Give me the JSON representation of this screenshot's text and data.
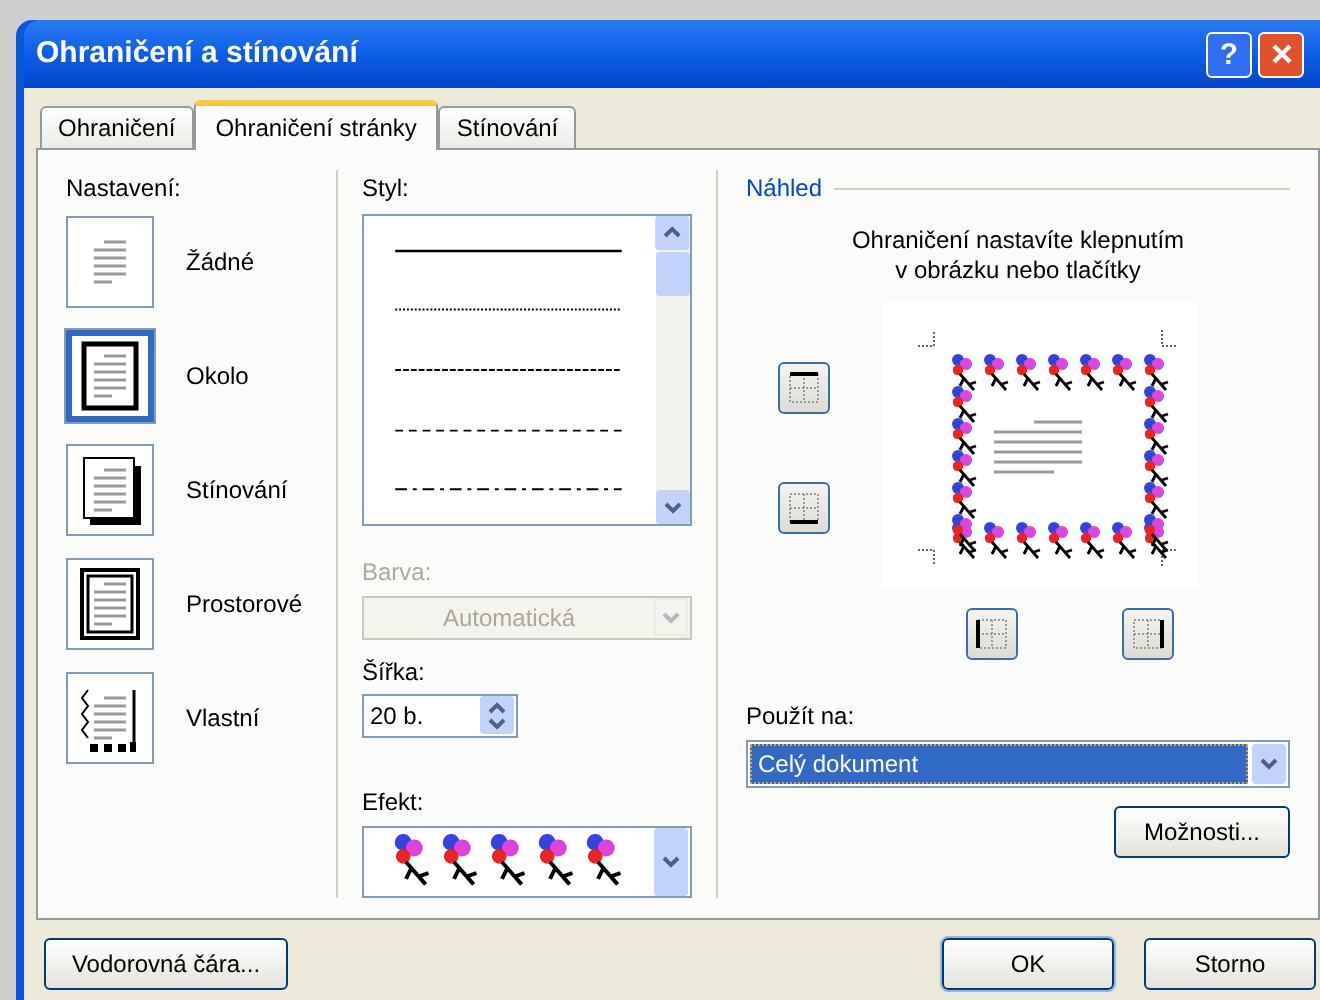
{
  "window": {
    "title": "Ohraničení a stínování",
    "help": "?"
  },
  "tabs": [
    {
      "label": "Ohraničení",
      "selected": false
    },
    {
      "label": "Ohraničení stránky",
      "selected": true
    },
    {
      "label": "Stínování",
      "selected": false
    }
  ],
  "settings": {
    "label": "Nastavení:",
    "items": [
      {
        "label": "Žádné",
        "kind": "none",
        "selected": false
      },
      {
        "label": "Okolo",
        "kind": "box",
        "selected": true
      },
      {
        "label": "Stínování",
        "kind": "shadow",
        "selected": false
      },
      {
        "label": "Prostorové",
        "kind": "threedee",
        "selected": false
      },
      {
        "label": "Vlastní",
        "kind": "custom",
        "selected": false
      }
    ]
  },
  "style": {
    "label": "Styl:"
  },
  "color": {
    "label": "Barva:",
    "value": "Automatická",
    "disabled": true
  },
  "width": {
    "label": "Šířka:",
    "value": "20 b."
  },
  "effect": {
    "label": "Efekt:"
  },
  "preview": {
    "title": "Náhled",
    "hint_lines": [
      "Ohraničení nastavíte klepnutím",
      "v obrázku nebo tlačítky"
    ]
  },
  "apply_to": {
    "label": "Použít na:",
    "value": "Celý dokument"
  },
  "buttons": {
    "options": "Možnosti...",
    "horizontal_line": "Vodorovná čára...",
    "ok": "OK",
    "cancel": "Storno"
  }
}
